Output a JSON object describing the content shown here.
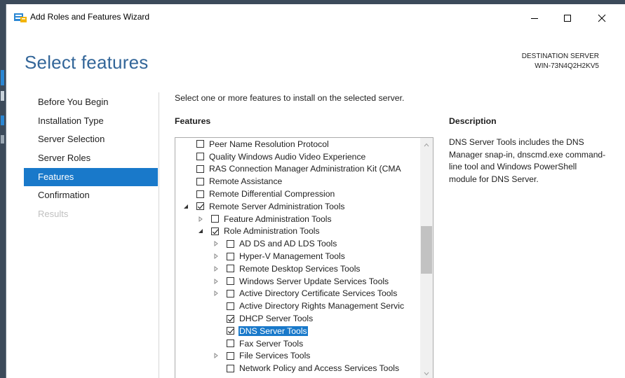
{
  "window": {
    "title": "Add Roles and Features Wizard"
  },
  "header": {
    "page_title": "Select features",
    "destination_label": "DESTINATION SERVER",
    "destination_server": "WIN-73N4Q2H2KV5"
  },
  "steps": [
    {
      "label": "Before You Begin",
      "state": "normal"
    },
    {
      "label": "Installation Type",
      "state": "normal"
    },
    {
      "label": "Server Selection",
      "state": "normal"
    },
    {
      "label": "Server Roles",
      "state": "normal"
    },
    {
      "label": "Features",
      "state": "active"
    },
    {
      "label": "Confirmation",
      "state": "normal"
    },
    {
      "label": "Results",
      "state": "disabled"
    }
  ],
  "main": {
    "instruction": "Select one or more features to install on the selected server.",
    "features_label": "Features",
    "description_label": "Description",
    "description_text": "DNS Server Tools includes the DNS Manager snap-in, dnscmd.exe command-line tool and Windows PowerShell module for DNS Server."
  },
  "tree": [
    {
      "label": "Peer Name Resolution Protocol",
      "level": 0,
      "expander": "none",
      "checked": false
    },
    {
      "label": "Quality Windows Audio Video Experience",
      "level": 0,
      "expander": "none",
      "checked": false
    },
    {
      "label": "RAS Connection Manager Administration Kit (CMA",
      "level": 0,
      "expander": "none",
      "checked": false
    },
    {
      "label": "Remote Assistance",
      "level": 0,
      "expander": "none",
      "checked": false
    },
    {
      "label": "Remote Differential Compression",
      "level": 0,
      "expander": "none",
      "checked": false
    },
    {
      "label": "Remote Server Administration Tools",
      "level": 0,
      "expander": "expanded",
      "checked": true
    },
    {
      "label": "Feature Administration Tools",
      "level": 1,
      "expander": "collapsed",
      "checked": false
    },
    {
      "label": "Role Administration Tools",
      "level": 1,
      "expander": "expanded",
      "checked": true
    },
    {
      "label": "AD DS and AD LDS Tools",
      "level": 2,
      "expander": "collapsed",
      "checked": false
    },
    {
      "label": "Hyper-V Management Tools",
      "level": 2,
      "expander": "collapsed",
      "checked": false
    },
    {
      "label": "Remote Desktop Services Tools",
      "level": 2,
      "expander": "collapsed",
      "checked": false
    },
    {
      "label": "Windows Server Update Services Tools",
      "level": 2,
      "expander": "collapsed",
      "checked": false
    },
    {
      "label": "Active Directory Certificate Services Tools",
      "level": 2,
      "expander": "collapsed",
      "checked": false
    },
    {
      "label": "Active Directory Rights Management Servic",
      "level": 2,
      "expander": "none",
      "checked": false
    },
    {
      "label": "DHCP Server Tools",
      "level": 2,
      "expander": "none",
      "checked": true
    },
    {
      "label": "DNS Server Tools",
      "level": 2,
      "expander": "none",
      "checked": true,
      "selected": true
    },
    {
      "label": "Fax Server Tools",
      "level": 2,
      "expander": "none",
      "checked": false
    },
    {
      "label": "File Services Tools",
      "level": 2,
      "expander": "collapsed",
      "checked": false
    },
    {
      "label": "Network Policy and Access Services Tools",
      "level": 2,
      "expander": "none",
      "checked": false
    }
  ],
  "colors": {
    "accent": "#1979ca",
    "title_blue": "#336699"
  }
}
